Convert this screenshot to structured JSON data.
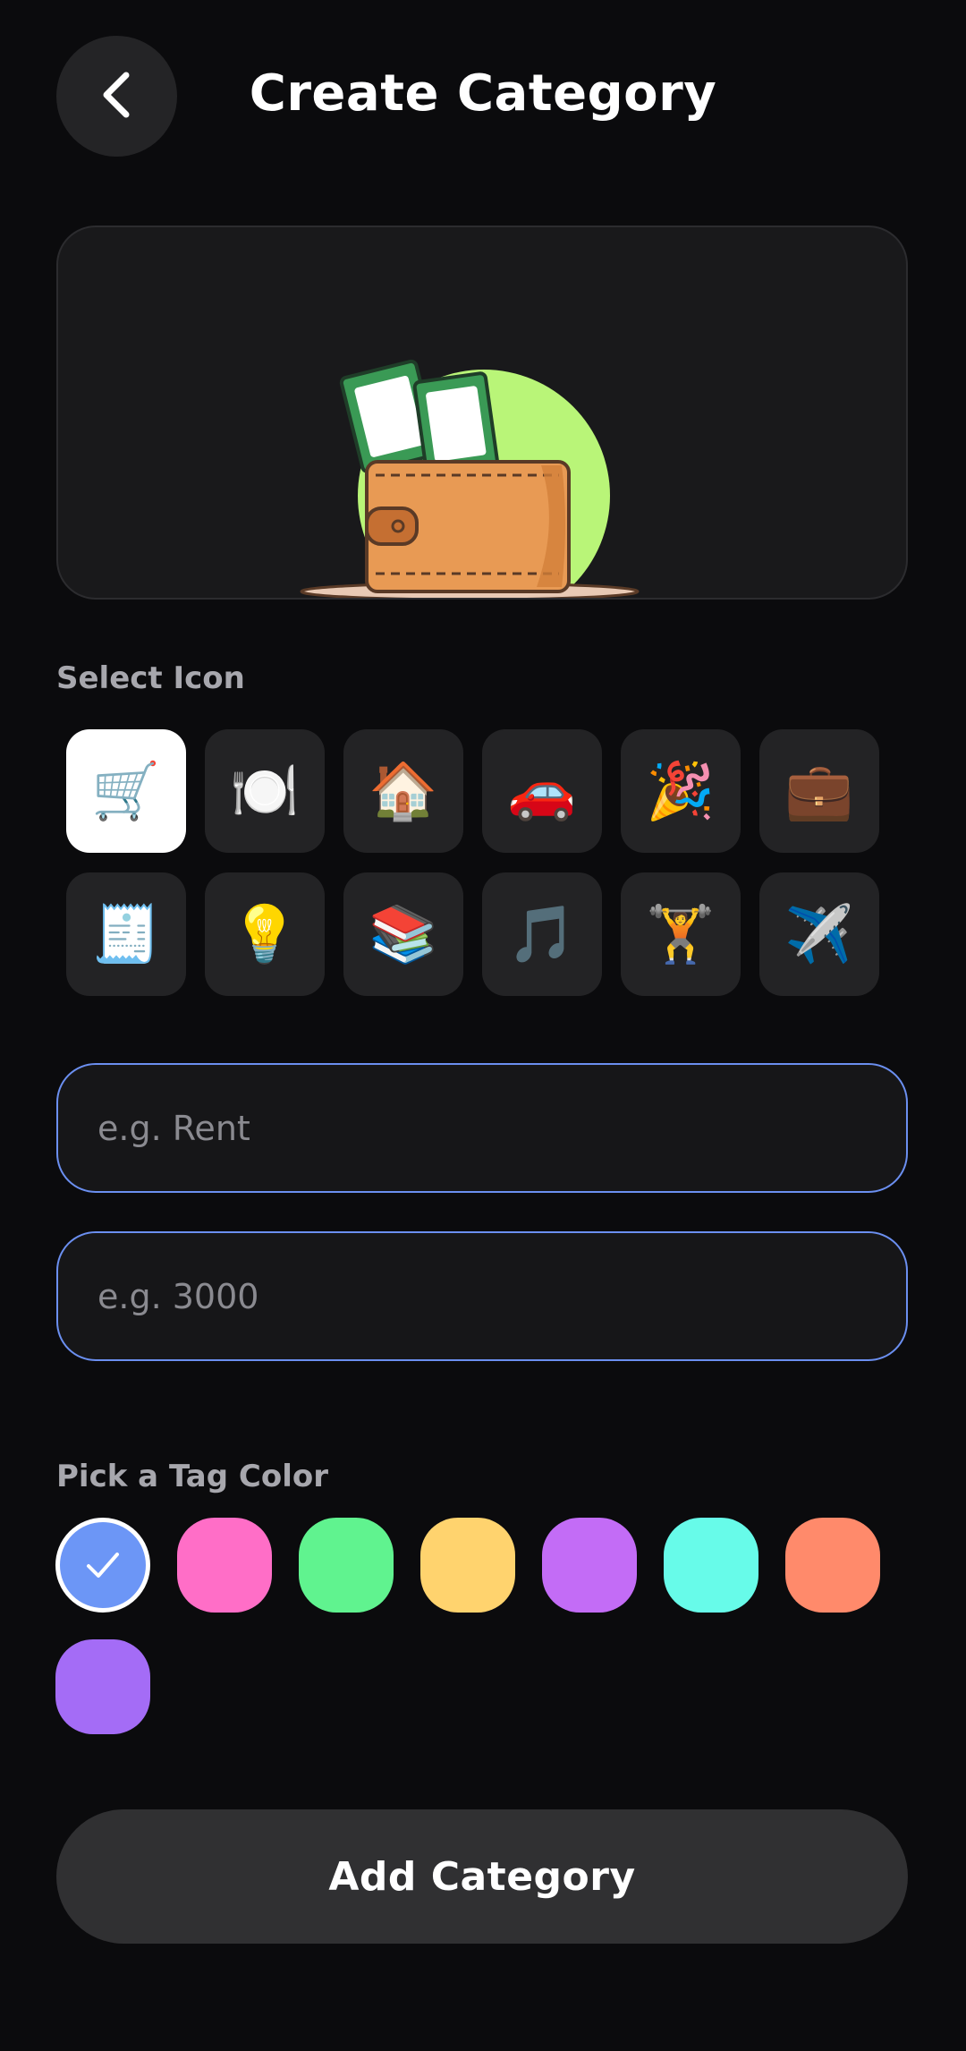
{
  "header": {
    "title": "Create Category"
  },
  "icon_section": {
    "label": "Select Icon",
    "icons": [
      {
        "name": "shopping-cart-icon",
        "glyph": "🛒",
        "selected": true
      },
      {
        "name": "fork-knife-plate-icon",
        "glyph": "🍽️",
        "selected": false
      },
      {
        "name": "house-icon",
        "glyph": "🏠",
        "selected": false
      },
      {
        "name": "car-icon",
        "glyph": "🚗",
        "selected": false
      },
      {
        "name": "party-popper-icon",
        "glyph": "🎉",
        "selected": false
      },
      {
        "name": "briefcase-icon",
        "glyph": "💼",
        "selected": false
      },
      {
        "name": "receipt-icon",
        "glyph": "🧾",
        "selected": false
      },
      {
        "name": "light-bulb-icon",
        "glyph": "💡",
        "selected": false
      },
      {
        "name": "books-icon",
        "glyph": "📚",
        "selected": false
      },
      {
        "name": "music-note-icon",
        "glyph": "🎵",
        "selected": false
      },
      {
        "name": "weight-lifter-icon",
        "glyph": "🏋️",
        "selected": false
      },
      {
        "name": "airplane-icon",
        "glyph": "✈️",
        "selected": false
      }
    ]
  },
  "form": {
    "name_placeholder": "e.g. Rent",
    "budget_placeholder": "e.g. 3000"
  },
  "color_section": {
    "label": "Pick a Tag Color",
    "colors": [
      {
        "hex": "#6c96f6",
        "selected": true
      },
      {
        "hex": "#ff6ec7",
        "selected": false
      },
      {
        "hex": "#60f38f",
        "selected": false
      },
      {
        "hex": "#ffd36e",
        "selected": false
      },
      {
        "hex": "#c36cf6",
        "selected": false
      },
      {
        "hex": "#67fbe9",
        "selected": false
      },
      {
        "hex": "#ff8a6b",
        "selected": false
      },
      {
        "hex": "#a46cf6",
        "selected": false
      }
    ]
  },
  "actions": {
    "submit_label": "Add Category"
  },
  "hero": {
    "illustration": "wallet-with-money-icon"
  }
}
